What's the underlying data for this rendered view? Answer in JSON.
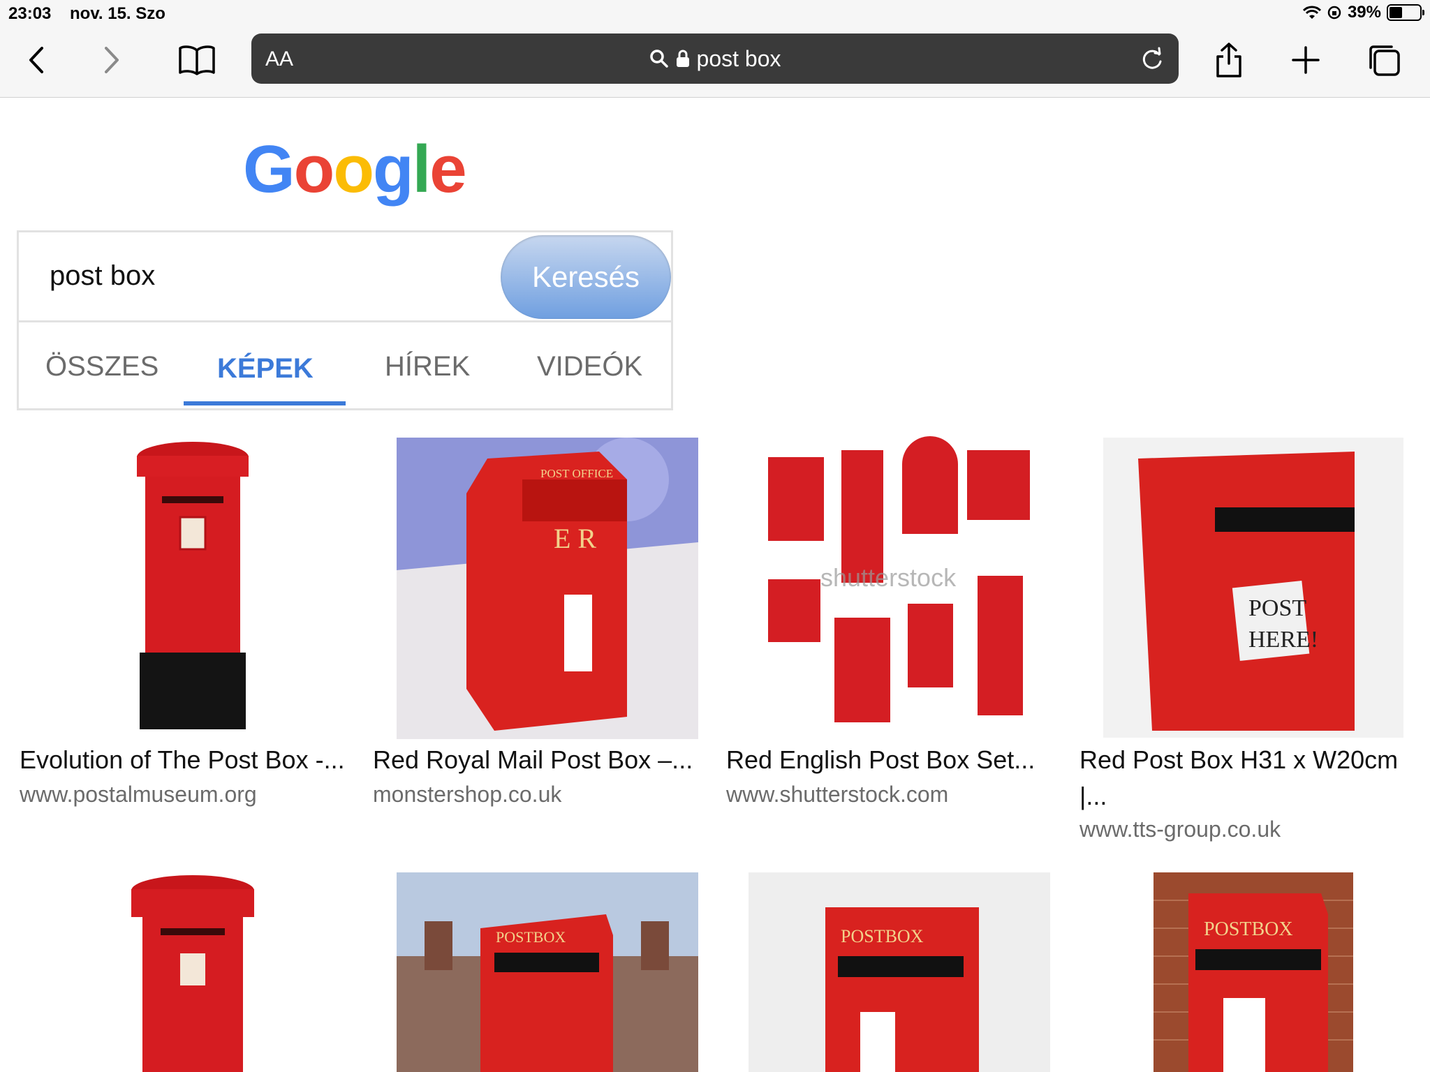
{
  "status": {
    "time": "23:03",
    "date": "nov. 15. Szo",
    "battery": "39%",
    "battery_level": 0.39
  },
  "toolbar": {
    "aa_label": "AA",
    "address": "post box"
  },
  "logo_text": [
    "G",
    "o",
    "o",
    "g",
    "l",
    "e"
  ],
  "search": {
    "query": "post box",
    "button_label": "Keresés",
    "tabs": [
      "ÖSSZES",
      "KÉPEK",
      "HÍREK",
      "VIDEÓK"
    ],
    "active_tab": "KÉPEK"
  },
  "results": [
    {
      "caption": "Evolution of The Post Box -...",
      "source": "www.postalmuseum.org"
    },
    {
      "caption": "Red Royal Mail Post Box –...",
      "source": "monstershop.co.uk"
    },
    {
      "caption": "Red English Post Box Set...",
      "source": "www.shutterstock.com"
    },
    {
      "caption": "Red Post Box H31 x W20cm",
      "caption_line2": "|...",
      "source": "www.tts-group.co.uk"
    }
  ],
  "thumb_text": {
    "post_office": "POST OFFICE",
    "eiir": "E R",
    "post_here_1": "POST",
    "post_here_2": "HERE!",
    "postbox": "POSTBOX",
    "watermark": "shutterstock"
  },
  "colors": {
    "red": "#d7191c",
    "accent": "#3c7ad9"
  }
}
